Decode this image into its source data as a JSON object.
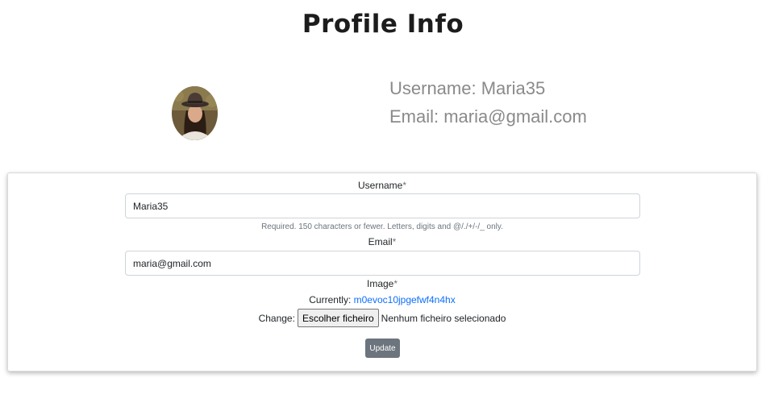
{
  "page": {
    "title": "Profile Info"
  },
  "profile": {
    "avatar_icon": "profile-photo",
    "username_line": "Username: Maria35",
    "email_line": "Email: maria@gmail.com"
  },
  "form": {
    "username": {
      "label": "Username",
      "required_mark": "*",
      "value": "Maria35",
      "help": "Required. 150 characters or fewer. Letters, digits and @/./+/-/_ only."
    },
    "email": {
      "label": "Email",
      "required_mark": "*",
      "value": "maria@gmail.com"
    },
    "image": {
      "label": "Image",
      "required_mark": "*",
      "currently_label": "Currently:",
      "current_file": "m0evoc10jpgefwf4n4hx",
      "change_label": "Change:",
      "choose_button": "Escolher ficheiro",
      "no_file_text": "Nenhum ficheiro selecionado"
    },
    "submit_label": "Update"
  }
}
